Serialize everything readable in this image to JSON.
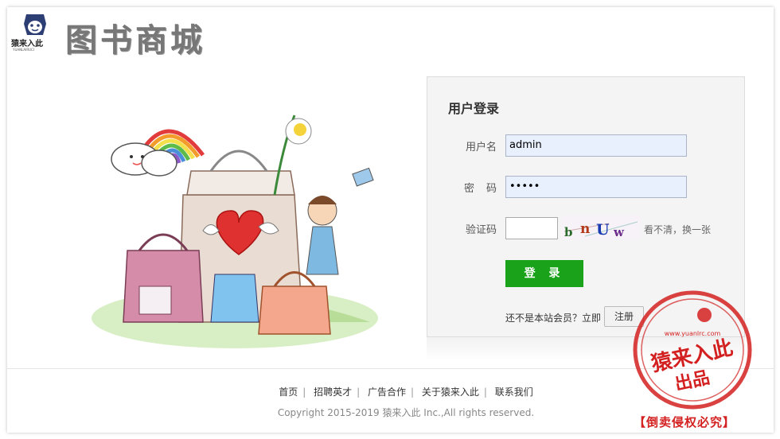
{
  "header": {
    "logo_text": "猿来入此",
    "logo_sub": "YUANLAIRUCI",
    "site_title": "图书商城"
  },
  "login": {
    "title": "用户登录",
    "username_label": "用户名",
    "username_value": "admin",
    "password_label": "密　码",
    "password_value": "•••••",
    "code_label": "验证码",
    "captcha_text": "bnUw",
    "captcha_refresh": "看不清，换一张",
    "login_button": "登 录",
    "register_prompt": "还不是本站会员？立即",
    "register_button": "注册"
  },
  "footer": {
    "links": [
      "首页",
      "招聘英才",
      "广告合作",
      "关于猿来入此",
      "联系我们"
    ],
    "copyright": "Copyright 2015-2019 猿来入此 Inc.,All rights reserved."
  },
  "seal": {
    "url": "www.yuanlrc.com",
    "line1": "猿来入此",
    "line2": "出品"
  },
  "notice": "【倒卖侵权必究】",
  "colors": {
    "primary_button": "#1aa31a",
    "seal_red": "#d32020",
    "input_bg": "#e8f0fe"
  }
}
